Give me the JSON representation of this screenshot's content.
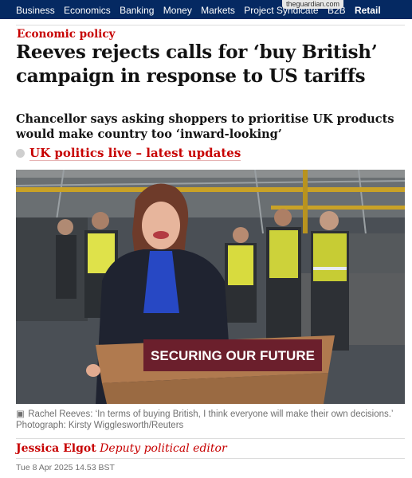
{
  "browser": {
    "url": "theguardian.com"
  },
  "nav": {
    "items": [
      "Business",
      "Economics",
      "Banking",
      "Money",
      "Markets",
      "Project Syndicate",
      "B2B",
      "Retail"
    ],
    "active": "Retail"
  },
  "article": {
    "kicker": "Economic policy",
    "headline": "Reeves rejects calls for ‘buy British’ campaign in response to US tariffs",
    "standfirst": "Chancellor says asking shoppers to prioritise UK products would make country too ‘inward-looking’",
    "live_link": "UK politics live – latest updates",
    "image": {
      "lectern_sign": "SECURING OUR FUTURE",
      "caption": "Rachel Reeves: ‘In terms of buying British, I think everyone will make their own decisions.’",
      "credit": "Photograph: Kirsty Wigglesworth/Reuters"
    },
    "byline": {
      "name": "Jessica Elgot",
      "role": "Deputy political editor"
    },
    "dateline": "Tue 8 Apr 2025 14.53 BST"
  },
  "colors": {
    "accent": "#c70000",
    "nav_bg": "#052962",
    "text": "#121212",
    "meta": "#707070"
  },
  "icons": {
    "caption": "camera-icon",
    "live": "live-dot-icon"
  }
}
